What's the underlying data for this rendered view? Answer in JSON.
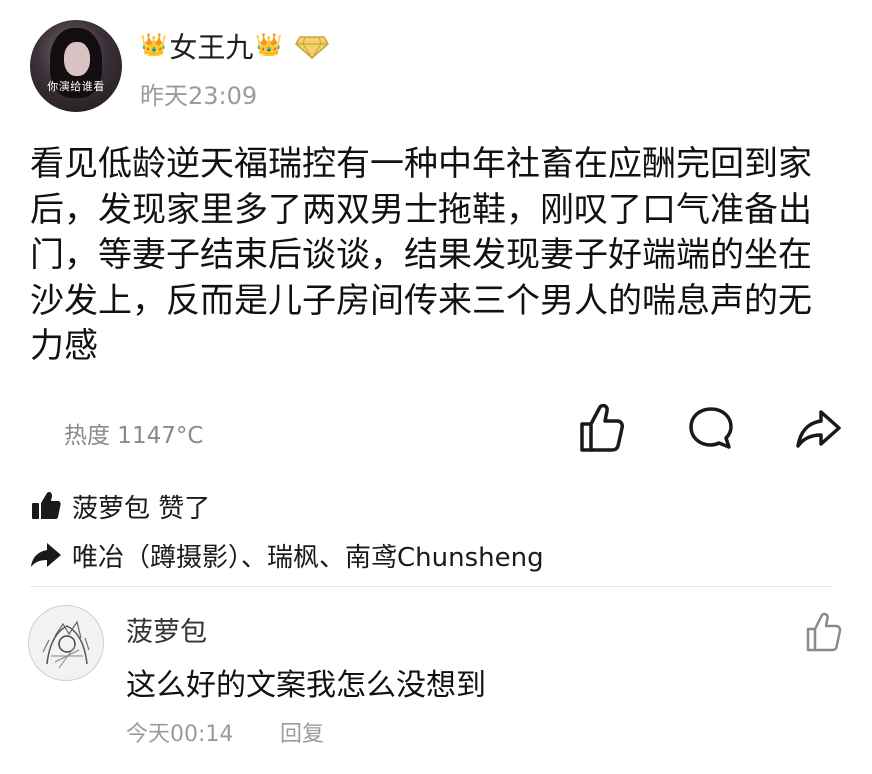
{
  "post": {
    "author": {
      "name": "女王九",
      "crown_left": "👑",
      "crown_right": "👑",
      "avatar_caption": "你演给谁看",
      "badge_icon": "vip-diamond-icon"
    },
    "time": "昨天23:09",
    "body": "看见低龄逆天福瑞控有一种中年社畜在应酬完回到家后，发现家里多了两双男士拖鞋，刚叹了口气准备出门，等妻子结束后谈谈，结果发现妻子好端端的坐在沙发上，反而是儿子房间传来三个男人的喘息声的无力感",
    "heat": "热度 1147°C",
    "actions": {
      "like_icon": "thumbs-up-icon",
      "comment_icon": "comment-icon",
      "share_icon": "share-arrow-icon"
    }
  },
  "reactions": {
    "likes_text": "菠萝包 赞了",
    "reposts_text": "唯冶（蹲摄影）、瑞枫、南鸢Chunsheng"
  },
  "comments": [
    {
      "author": "菠萝包",
      "text": "这么好的文案我怎么没想到",
      "time": "今天00:14",
      "reply_label": "回复"
    }
  ],
  "colors": {
    "text": "#111111",
    "muted": "#9b9b9b",
    "crown": "#e5b733",
    "divider": "#e6e6e6"
  }
}
